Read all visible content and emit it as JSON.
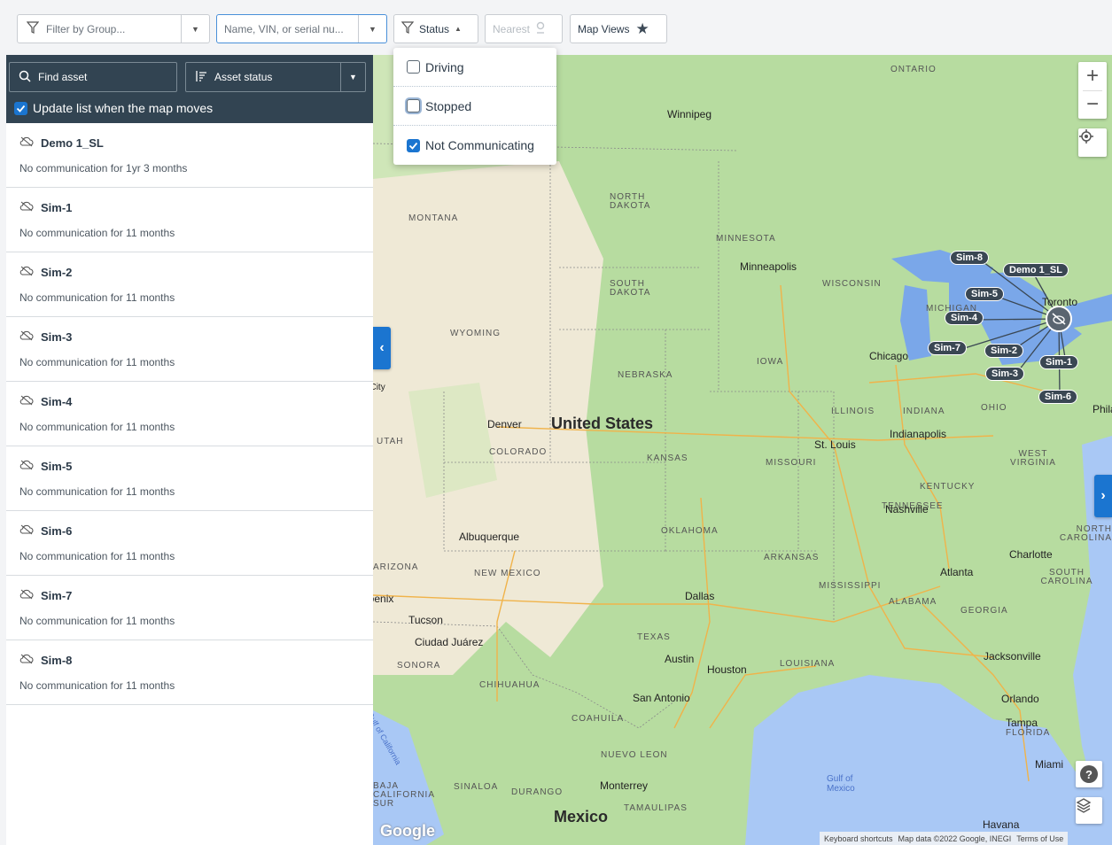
{
  "toolbar": {
    "filter_group_placeholder": "Filter by Group...",
    "search_placeholder": "Name, VIN, or serial nu...",
    "status_label": "Status",
    "nearest_label": "Nearest",
    "map_views_label": "Map Views"
  },
  "status_menu": {
    "items": [
      {
        "label": "Driving",
        "checked": false
      },
      {
        "label": "Stopped",
        "checked": false
      },
      {
        "label": "Not Communicating",
        "checked": true
      }
    ]
  },
  "sidebar": {
    "find_asset_label": "Find asset",
    "asset_status_label": "Asset status",
    "update_list_label": "Update list when the map moves",
    "update_list_checked": true,
    "assets": [
      {
        "name": "Demo 1_SL",
        "status": "No communication for 1yr 3 months"
      },
      {
        "name": "Sim-1",
        "status": "No communication for 11 months"
      },
      {
        "name": "Sim-2",
        "status": "No communication for 11 months"
      },
      {
        "name": "Sim-3",
        "status": "No communication for 11 months"
      },
      {
        "name": "Sim-4",
        "status": "No communication for 11 months"
      },
      {
        "name": "Sim-5",
        "status": "No communication for 11 months"
      },
      {
        "name": "Sim-6",
        "status": "No communication for 11 months"
      },
      {
        "name": "Sim-7",
        "status": "No communication for 11 months"
      },
      {
        "name": "Sim-8",
        "status": "No communication for 11 months"
      }
    ]
  },
  "map": {
    "states": [
      "ONTARIO",
      "NORTH DAKOTA",
      "MONTANA",
      "MINNESOTA",
      "WISCONSIN",
      "SOUTH DAKOTA",
      "MICHIGAN",
      "WYOMING",
      "IOWA",
      "NEBRASKA",
      "ILLINOIS",
      "INDIANA",
      "OHIO",
      "UTAH",
      "COLORADO",
      "KANSAS",
      "MISSOURI",
      "WEST VIRGINIA",
      "KENTUCKY",
      "TENNESSEE",
      "NORTH CAROLINA",
      "OKLAHOMA",
      "ARKANSAS",
      "ARIZONA",
      "NEW MEXICO",
      "MISSISSIPPI",
      "SOUTH CAROLINA",
      "ALABAMA",
      "GEORGIA",
      "TEXAS",
      "LOUISIANA",
      "SONORA",
      "CHIHUAHUA",
      "COAHUILA",
      "NUEVO LEON",
      "BAJA CALIFORNIA SUR",
      "SINALOA",
      "DURANGO",
      "TAMAULIPAS",
      "FLORIDA"
    ],
    "cities": [
      "Winnipeg",
      "Minneapolis",
      "Chicago",
      "Indianapolis",
      "St. Louis",
      "Nashville",
      "Charlotte",
      "Atlanta",
      "Denver",
      "Albuquerque",
      "Phoenix",
      "Tucson",
      "Ciudad Juárez",
      "Dallas",
      "Austin",
      "Houston",
      "San Antonio",
      "Jacksonville",
      "Orlando",
      "Tampa",
      "Miami",
      "Monterrey",
      "Havana",
      "Salt Lake City",
      "Toronto",
      "Philadelphia"
    ],
    "country_us": "United States",
    "country_mx": "Mexico",
    "water_gulf": "Gulf of Mexico",
    "water_gulf_ca": "Gulf of California",
    "markers": [
      "Sim-8",
      "Demo 1_SL",
      "Sim-5",
      "Sim-4",
      "Sim-7",
      "Sim-2",
      "Sim-1",
      "Sim-3",
      "Sim-6"
    ],
    "attribution": {
      "logo": "Google",
      "shortcuts": "Keyboard shortcuts",
      "data": "Map data ©2022 Google, INEGI",
      "terms": "Terms of Use"
    },
    "colors": {
      "land": "#b7dca0",
      "desert": "#efe9d6",
      "water": "#a9c8f5",
      "lakes": "#7aa7e9",
      "marker": "#3a4753"
    }
  }
}
